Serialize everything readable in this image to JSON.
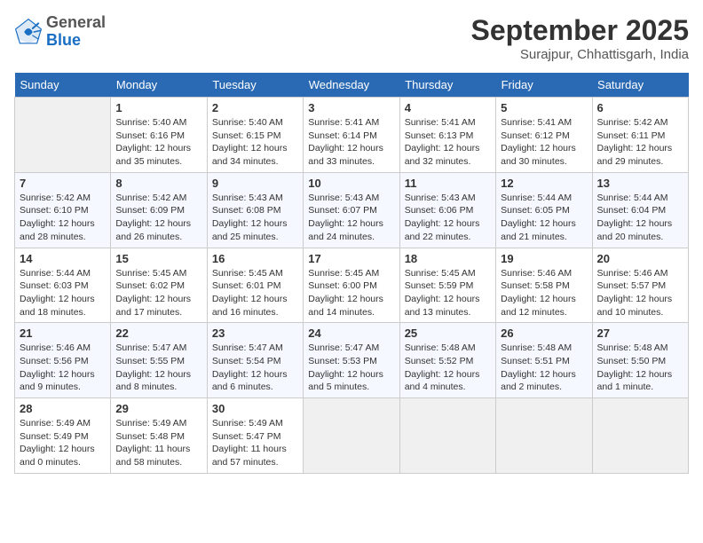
{
  "logo": {
    "general": "General",
    "blue": "Blue"
  },
  "header": {
    "month": "September 2025",
    "location": "Surajpur, Chhattisgarh, India"
  },
  "weekdays": [
    "Sunday",
    "Monday",
    "Tuesday",
    "Wednesday",
    "Thursday",
    "Friday",
    "Saturday"
  ],
  "weeks": [
    [
      {
        "day": "",
        "empty": true
      },
      {
        "day": "1",
        "sunrise": "Sunrise: 5:40 AM",
        "sunset": "Sunset: 6:16 PM",
        "daylight": "Daylight: 12 hours and 35 minutes."
      },
      {
        "day": "2",
        "sunrise": "Sunrise: 5:40 AM",
        "sunset": "Sunset: 6:15 PM",
        "daylight": "Daylight: 12 hours and 34 minutes."
      },
      {
        "day": "3",
        "sunrise": "Sunrise: 5:41 AM",
        "sunset": "Sunset: 6:14 PM",
        "daylight": "Daylight: 12 hours and 33 minutes."
      },
      {
        "day": "4",
        "sunrise": "Sunrise: 5:41 AM",
        "sunset": "Sunset: 6:13 PM",
        "daylight": "Daylight: 12 hours and 32 minutes."
      },
      {
        "day": "5",
        "sunrise": "Sunrise: 5:41 AM",
        "sunset": "Sunset: 6:12 PM",
        "daylight": "Daylight: 12 hours and 30 minutes."
      },
      {
        "day": "6",
        "sunrise": "Sunrise: 5:42 AM",
        "sunset": "Sunset: 6:11 PM",
        "daylight": "Daylight: 12 hours and 29 minutes."
      }
    ],
    [
      {
        "day": "7",
        "sunrise": "Sunrise: 5:42 AM",
        "sunset": "Sunset: 6:10 PM",
        "daylight": "Daylight: 12 hours and 28 minutes."
      },
      {
        "day": "8",
        "sunrise": "Sunrise: 5:42 AM",
        "sunset": "Sunset: 6:09 PM",
        "daylight": "Daylight: 12 hours and 26 minutes."
      },
      {
        "day": "9",
        "sunrise": "Sunrise: 5:43 AM",
        "sunset": "Sunset: 6:08 PM",
        "daylight": "Daylight: 12 hours and 25 minutes."
      },
      {
        "day": "10",
        "sunrise": "Sunrise: 5:43 AM",
        "sunset": "Sunset: 6:07 PM",
        "daylight": "Daylight: 12 hours and 24 minutes."
      },
      {
        "day": "11",
        "sunrise": "Sunrise: 5:43 AM",
        "sunset": "Sunset: 6:06 PM",
        "daylight": "Daylight: 12 hours and 22 minutes."
      },
      {
        "day": "12",
        "sunrise": "Sunrise: 5:44 AM",
        "sunset": "Sunset: 6:05 PM",
        "daylight": "Daylight: 12 hours and 21 minutes."
      },
      {
        "day": "13",
        "sunrise": "Sunrise: 5:44 AM",
        "sunset": "Sunset: 6:04 PM",
        "daylight": "Daylight: 12 hours and 20 minutes."
      }
    ],
    [
      {
        "day": "14",
        "sunrise": "Sunrise: 5:44 AM",
        "sunset": "Sunset: 6:03 PM",
        "daylight": "Daylight: 12 hours and 18 minutes."
      },
      {
        "day": "15",
        "sunrise": "Sunrise: 5:45 AM",
        "sunset": "Sunset: 6:02 PM",
        "daylight": "Daylight: 12 hours and 17 minutes."
      },
      {
        "day": "16",
        "sunrise": "Sunrise: 5:45 AM",
        "sunset": "Sunset: 6:01 PM",
        "daylight": "Daylight: 12 hours and 16 minutes."
      },
      {
        "day": "17",
        "sunrise": "Sunrise: 5:45 AM",
        "sunset": "Sunset: 6:00 PM",
        "daylight": "Daylight: 12 hours and 14 minutes."
      },
      {
        "day": "18",
        "sunrise": "Sunrise: 5:45 AM",
        "sunset": "Sunset: 5:59 PM",
        "daylight": "Daylight: 12 hours and 13 minutes."
      },
      {
        "day": "19",
        "sunrise": "Sunrise: 5:46 AM",
        "sunset": "Sunset: 5:58 PM",
        "daylight": "Daylight: 12 hours and 12 minutes."
      },
      {
        "day": "20",
        "sunrise": "Sunrise: 5:46 AM",
        "sunset": "Sunset: 5:57 PM",
        "daylight": "Daylight: 12 hours and 10 minutes."
      }
    ],
    [
      {
        "day": "21",
        "sunrise": "Sunrise: 5:46 AM",
        "sunset": "Sunset: 5:56 PM",
        "daylight": "Daylight: 12 hours and 9 minutes."
      },
      {
        "day": "22",
        "sunrise": "Sunrise: 5:47 AM",
        "sunset": "Sunset: 5:55 PM",
        "daylight": "Daylight: 12 hours and 8 minutes."
      },
      {
        "day": "23",
        "sunrise": "Sunrise: 5:47 AM",
        "sunset": "Sunset: 5:54 PM",
        "daylight": "Daylight: 12 hours and 6 minutes."
      },
      {
        "day": "24",
        "sunrise": "Sunrise: 5:47 AM",
        "sunset": "Sunset: 5:53 PM",
        "daylight": "Daylight: 12 hours and 5 minutes."
      },
      {
        "day": "25",
        "sunrise": "Sunrise: 5:48 AM",
        "sunset": "Sunset: 5:52 PM",
        "daylight": "Daylight: 12 hours and 4 minutes."
      },
      {
        "day": "26",
        "sunrise": "Sunrise: 5:48 AM",
        "sunset": "Sunset: 5:51 PM",
        "daylight": "Daylight: 12 hours and 2 minutes."
      },
      {
        "day": "27",
        "sunrise": "Sunrise: 5:48 AM",
        "sunset": "Sunset: 5:50 PM",
        "daylight": "Daylight: 12 hours and 1 minute."
      }
    ],
    [
      {
        "day": "28",
        "sunrise": "Sunrise: 5:49 AM",
        "sunset": "Sunset: 5:49 PM",
        "daylight": "Daylight: 12 hours and 0 minutes."
      },
      {
        "day": "29",
        "sunrise": "Sunrise: 5:49 AM",
        "sunset": "Sunset: 5:48 PM",
        "daylight": "Daylight: 11 hours and 58 minutes."
      },
      {
        "day": "30",
        "sunrise": "Sunrise: 5:49 AM",
        "sunset": "Sunset: 5:47 PM",
        "daylight": "Daylight: 11 hours and 57 minutes."
      },
      {
        "day": "",
        "empty": true
      },
      {
        "day": "",
        "empty": true
      },
      {
        "day": "",
        "empty": true
      },
      {
        "day": "",
        "empty": true
      }
    ]
  ]
}
